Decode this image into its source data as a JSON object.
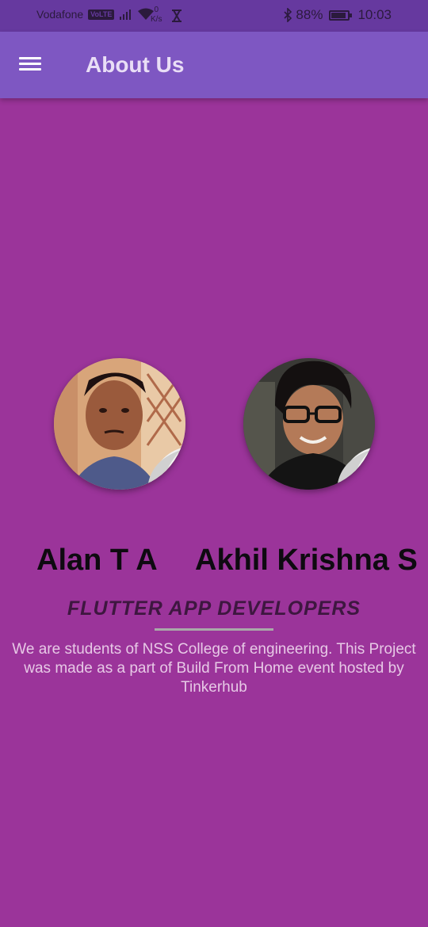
{
  "status_bar": {
    "carrier": "Vodafone",
    "volte": "VoLTE",
    "speed_value": "0",
    "speed_unit": "K/s",
    "battery": "88%",
    "time": "10:03"
  },
  "app_bar": {
    "title": "About Us",
    "menu_icon": "hamburger-menu-icon"
  },
  "team": [
    {
      "name": "Alan T A"
    },
    {
      "name": "Akhil Krishna S"
    }
  ],
  "role": "FLUTTER APP DEVELOPERS",
  "description": "We are students of NSS College of engineering. This Project was made as a part of Build From Home event hosted by Tinkerhub",
  "colors": {
    "background": "#9b349a",
    "app_bar": "#7e57c2",
    "status_bar": "#66399f",
    "divider": "#a9a9a9"
  }
}
